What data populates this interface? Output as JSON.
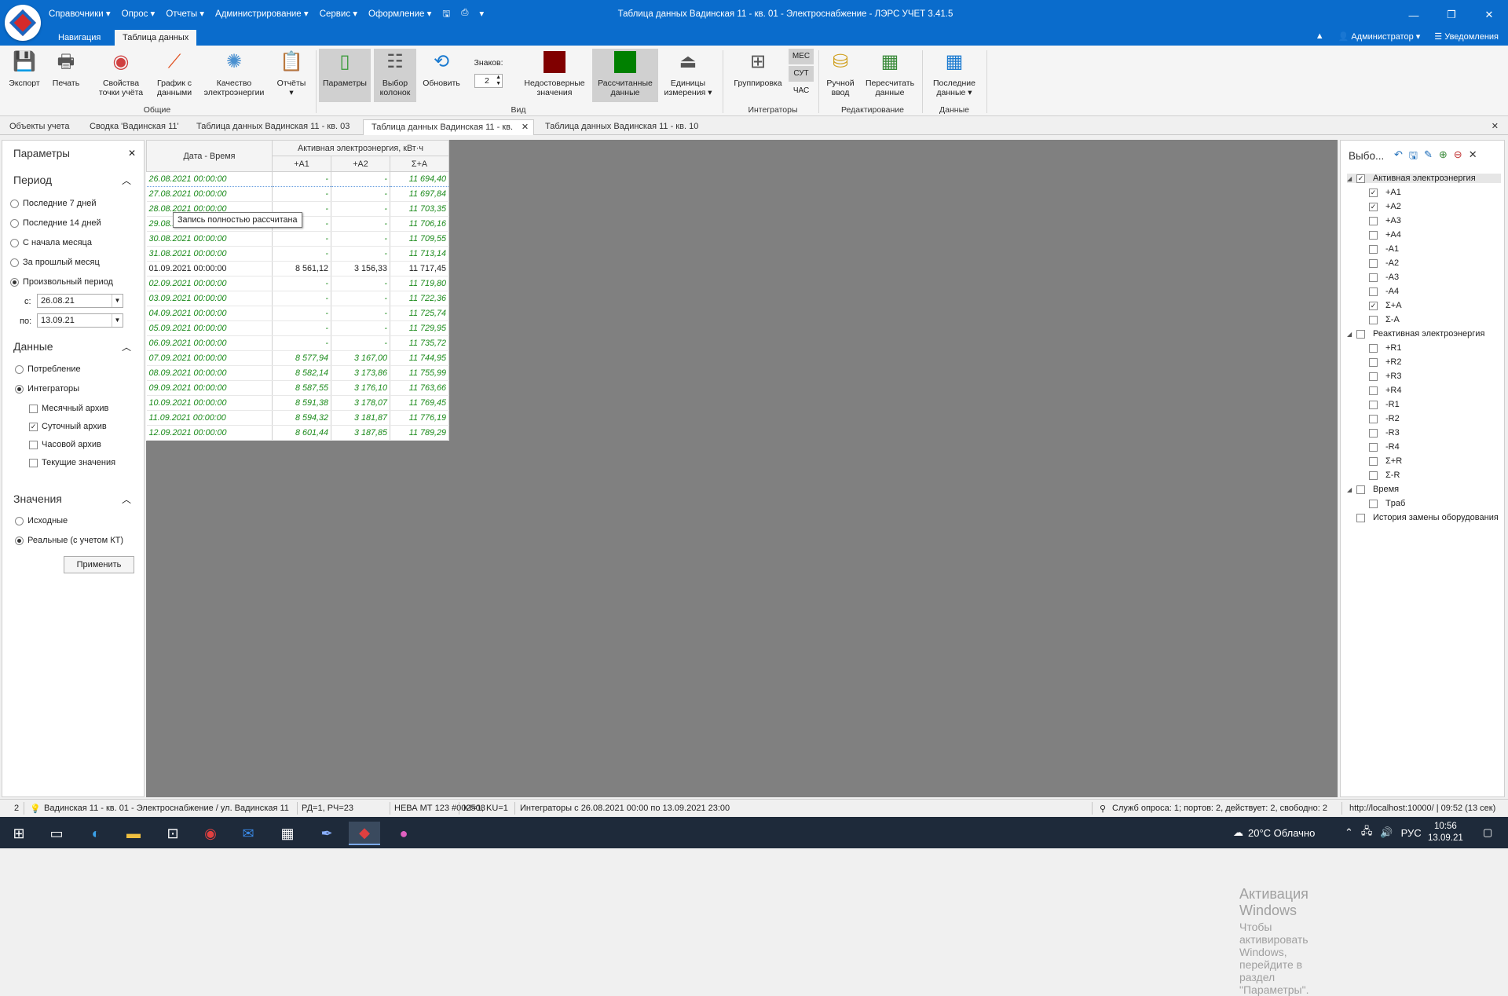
{
  "app": {
    "menu": [
      "Справочники ▾",
      "Опрос ▾",
      "Отчеты ▾",
      "Администрирование ▾",
      "Сервис ▾",
      "Оформление ▾"
    ],
    "title": "Таблица данных Вадинская 11 - кв. 01 - Электроснабжение - ЛЭРС УЧЕТ 3.41.5",
    "window_controls": [
      "—",
      "❐",
      "✕"
    ],
    "ribbon_tabs": [
      "Навигация",
      "Таблица данных"
    ],
    "user": "Администратор ▾",
    "notifications": "Уведомления",
    "collapse": "▲"
  },
  "ribbon": {
    "export": "Экспорт",
    "print": "Печать",
    "point_props": "Свойства\nточки учёта",
    "chart": "График с\nданными",
    "quality": "Качество\nэлектроэнергии",
    "reports": "Отчёты\n▾",
    "group_general": "Общие",
    "params": "Параметры",
    "select_cols": "Выбор\nколонок",
    "refresh": "Обновить",
    "digits_label": "Знаков:",
    "digits_value": "2",
    "unreliable": "Недостоверные\nзначения",
    "calculated": "Рассчитанные\nданные",
    "units": "Единицы\nизмерения ▾",
    "group_view": "Вид",
    "grouping": "Группировка",
    "mes": "МЕС",
    "sut": "СУТ",
    "chas": "ЧАС",
    "group_integrators": "Интеграторы",
    "manual": "Ручной\nввод",
    "recalc": "Пересчитать\nданные",
    "group_editing": "Редактирование",
    "last": "Последние\nданные ▾",
    "group_data": "Данные",
    "unreliable_color": "#800000",
    "calculated_color": "#008000"
  },
  "doc_tabs": [
    "Объекты учета",
    "Сводка 'Вадинская 11'",
    "Таблица данных Вадинская 11 - кв. 03",
    "Таблица данных Вадинская 11 - кв.",
    "Таблица данных Вадинская 11 - кв. 10"
  ],
  "left_panel": {
    "title": "Параметры",
    "close": "✕",
    "period_h": "Период",
    "periods": [
      "Последние 7 дней",
      "Последние 14 дней",
      "С начала месяца",
      "За прошлый месяц",
      "Произвольный период"
    ],
    "from_label": "с:",
    "from": "26.08.21",
    "to_label": "по:",
    "to": "13.09.21",
    "data_h": "Данные",
    "data_opts": [
      "Потребление",
      "Интеграторы"
    ],
    "archives": [
      "Месячный архив",
      "Суточный архив",
      "Часовой архив",
      "Текущие значения"
    ],
    "values_h": "Значения",
    "values_opts": [
      "Исходные",
      "Реальные (с учетом КТ)"
    ],
    "apply": "Применить"
  },
  "table": {
    "col_dt": "Дата - Время",
    "group": "Активная электроэнергия, кВт·ч",
    "cols": [
      "+A1",
      "+A2",
      "Σ+A"
    ],
    "rows": [
      {
        "dt": "26.08.2021 00:00:00",
        "a1": "-",
        "a2": "-",
        "sum": "11 694,40",
        "calc": true
      },
      {
        "dt": "27.08.2021 00:00:00",
        "a1": "-",
        "a2": "-",
        "sum": "11 697,84",
        "calc": true
      },
      {
        "dt": "28.08.2021 00:00:00",
        "a1": "-",
        "a2": "-",
        "sum": "11 703,35",
        "calc": true
      },
      {
        "dt": "29.08.2021 00:00:00",
        "a1": "-",
        "a2": "-",
        "sum": "11 706,16",
        "calc": true
      },
      {
        "dt": "30.08.2021 00:00:00",
        "a1": "-",
        "a2": "-",
        "sum": "11 709,55",
        "calc": true
      },
      {
        "dt": "31.08.2021 00:00:00",
        "a1": "-",
        "a2": "-",
        "sum": "11 713,14",
        "calc": true
      },
      {
        "dt": "01.09.2021 00:00:00",
        "a1": "8 561,12",
        "a2": "3 156,33",
        "sum": "11 717,45",
        "calc": false
      },
      {
        "dt": "02.09.2021 00:00:00",
        "a1": "-",
        "a2": "-",
        "sum": "11 719,80",
        "calc": true
      },
      {
        "dt": "03.09.2021 00:00:00",
        "a1": "-",
        "a2": "-",
        "sum": "11 722,36",
        "calc": true
      },
      {
        "dt": "04.09.2021 00:00:00",
        "a1": "-",
        "a2": "-",
        "sum": "11 725,74",
        "calc": true
      },
      {
        "dt": "05.09.2021 00:00:00",
        "a1": "-",
        "a2": "-",
        "sum": "11 729,95",
        "calc": true
      },
      {
        "dt": "06.09.2021 00:00:00",
        "a1": "-",
        "a2": "-",
        "sum": "11 735,72",
        "calc": true
      },
      {
        "dt": "07.09.2021 00:00:00",
        "a1": "8 577,94",
        "a2": "3 167,00",
        "sum": "11 744,95",
        "calc": true
      },
      {
        "dt": "08.09.2021 00:00:00",
        "a1": "8 582,14",
        "a2": "3 173,86",
        "sum": "11 755,99",
        "calc": true
      },
      {
        "dt": "09.09.2021 00:00:00",
        "a1": "8 587,55",
        "a2": "3 176,10",
        "sum": "11 763,66",
        "calc": true
      },
      {
        "dt": "10.09.2021 00:00:00",
        "a1": "8 591,38",
        "a2": "3 178,07",
        "sum": "11 769,45",
        "calc": true
      },
      {
        "dt": "11.09.2021 00:00:00",
        "a1": "8 594,32",
        "a2": "3 181,87",
        "sum": "11 776,19",
        "calc": true
      },
      {
        "dt": "12.09.2021 00:00:00",
        "a1": "8 601,44",
        "a2": "3 187,85",
        "sum": "11 789,29",
        "calc": true
      }
    ]
  },
  "tooltip": "Запись полностью рассчитана",
  "right_panel": {
    "title": "Выбо...",
    "close": "✕",
    "tree": [
      {
        "label": "Активная электроэнергия",
        "level": 0,
        "checked": true,
        "expander": "◢"
      },
      {
        "label": "+A1",
        "level": 1,
        "checked": true
      },
      {
        "label": "+A2",
        "level": 1,
        "checked": true
      },
      {
        "label": "+A3",
        "level": 1,
        "checked": false
      },
      {
        "label": "+A4",
        "level": 1,
        "checked": false
      },
      {
        "label": "-A1",
        "level": 1,
        "checked": false
      },
      {
        "label": "-A2",
        "level": 1,
        "checked": false
      },
      {
        "label": "-A3",
        "level": 1,
        "checked": false
      },
      {
        "label": "-A4",
        "level": 1,
        "checked": false
      },
      {
        "label": "Σ+A",
        "level": 1,
        "checked": true
      },
      {
        "label": "Σ-A",
        "level": 1,
        "checked": false
      },
      {
        "label": "Реактивная электроэнергия",
        "level": 0,
        "checked": false,
        "expander": "◢"
      },
      {
        "label": "+R1",
        "level": 1,
        "checked": false
      },
      {
        "label": "+R2",
        "level": 1,
        "checked": false
      },
      {
        "label": "+R3",
        "level": 1,
        "checked": false
      },
      {
        "label": "+R4",
        "level": 1,
        "checked": false
      },
      {
        "label": "-R1",
        "level": 1,
        "checked": false
      },
      {
        "label": "-R2",
        "level": 1,
        "checked": false
      },
      {
        "label": "-R3",
        "level": 1,
        "checked": false
      },
      {
        "label": "-R4",
        "level": 1,
        "checked": false
      },
      {
        "label": "Σ+R",
        "level": 1,
        "checked": false
      },
      {
        "label": "Σ-R",
        "level": 1,
        "checked": false
      },
      {
        "label": "Время",
        "level": 0,
        "checked": false,
        "expander": "◢"
      },
      {
        "label": "Tраб",
        "level": 1,
        "checked": false
      },
      {
        "label": "История замены оборудования",
        "level": 0,
        "checked": false,
        "expander": ""
      }
    ]
  },
  "watermark": {
    "line1": "Активация Windows",
    "line2": "Чтобы активировать Windows, перейдите в раздел \"Параметры\"."
  },
  "status": {
    "count": "2",
    "object": "Вадинская 11 - кв. 01 - Электроснабжение / ул. Вадинская 11",
    "rd": "РД=1, РЧ=23",
    "device": "НЕВА МТ 123 #002508",
    "ki": "KI=1, KU=1",
    "range": "Интеграторы с 26.08.2021 00:00 по 13.09.2021 23:00",
    "services": "Служб опроса: 1; портов: 2, действует: 2, свободно: 2",
    "server": "http://localhost:10000/ | 09:52 (13 сек)"
  },
  "taskbar": {
    "weather": "20°C Облачно",
    "lang": "РУС",
    "time": "10:56",
    "date": "13.09.21"
  }
}
